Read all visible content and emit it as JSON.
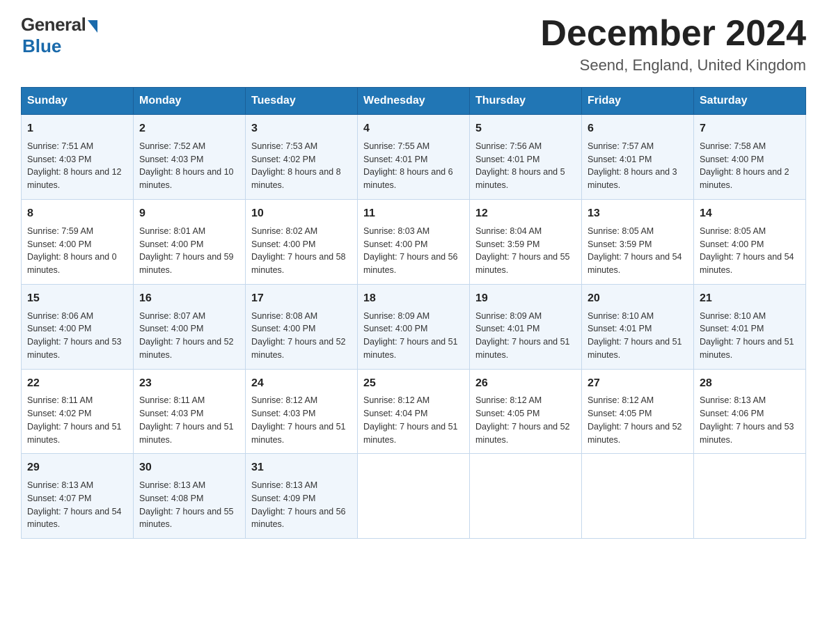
{
  "logo": {
    "general": "General",
    "blue": "Blue"
  },
  "title": "December 2024",
  "location": "Seend, England, United Kingdom",
  "days_of_week": [
    "Sunday",
    "Monday",
    "Tuesday",
    "Wednesday",
    "Thursday",
    "Friday",
    "Saturday"
  ],
  "weeks": [
    [
      {
        "day": "1",
        "sunrise": "7:51 AM",
        "sunset": "4:03 PM",
        "daylight": "8 hours and 12 minutes."
      },
      {
        "day": "2",
        "sunrise": "7:52 AM",
        "sunset": "4:03 PM",
        "daylight": "8 hours and 10 minutes."
      },
      {
        "day": "3",
        "sunrise": "7:53 AM",
        "sunset": "4:02 PM",
        "daylight": "8 hours and 8 minutes."
      },
      {
        "day": "4",
        "sunrise": "7:55 AM",
        "sunset": "4:01 PM",
        "daylight": "8 hours and 6 minutes."
      },
      {
        "day": "5",
        "sunrise": "7:56 AM",
        "sunset": "4:01 PM",
        "daylight": "8 hours and 5 minutes."
      },
      {
        "day": "6",
        "sunrise": "7:57 AM",
        "sunset": "4:01 PM",
        "daylight": "8 hours and 3 minutes."
      },
      {
        "day": "7",
        "sunrise": "7:58 AM",
        "sunset": "4:00 PM",
        "daylight": "8 hours and 2 minutes."
      }
    ],
    [
      {
        "day": "8",
        "sunrise": "7:59 AM",
        "sunset": "4:00 PM",
        "daylight": "8 hours and 0 minutes."
      },
      {
        "day": "9",
        "sunrise": "8:01 AM",
        "sunset": "4:00 PM",
        "daylight": "7 hours and 59 minutes."
      },
      {
        "day": "10",
        "sunrise": "8:02 AM",
        "sunset": "4:00 PM",
        "daylight": "7 hours and 58 minutes."
      },
      {
        "day": "11",
        "sunrise": "8:03 AM",
        "sunset": "4:00 PM",
        "daylight": "7 hours and 56 minutes."
      },
      {
        "day": "12",
        "sunrise": "8:04 AM",
        "sunset": "3:59 PM",
        "daylight": "7 hours and 55 minutes."
      },
      {
        "day": "13",
        "sunrise": "8:05 AM",
        "sunset": "3:59 PM",
        "daylight": "7 hours and 54 minutes."
      },
      {
        "day": "14",
        "sunrise": "8:05 AM",
        "sunset": "4:00 PM",
        "daylight": "7 hours and 54 minutes."
      }
    ],
    [
      {
        "day": "15",
        "sunrise": "8:06 AM",
        "sunset": "4:00 PM",
        "daylight": "7 hours and 53 minutes."
      },
      {
        "day": "16",
        "sunrise": "8:07 AM",
        "sunset": "4:00 PM",
        "daylight": "7 hours and 52 minutes."
      },
      {
        "day": "17",
        "sunrise": "8:08 AM",
        "sunset": "4:00 PM",
        "daylight": "7 hours and 52 minutes."
      },
      {
        "day": "18",
        "sunrise": "8:09 AM",
        "sunset": "4:00 PM",
        "daylight": "7 hours and 51 minutes."
      },
      {
        "day": "19",
        "sunrise": "8:09 AM",
        "sunset": "4:01 PM",
        "daylight": "7 hours and 51 minutes."
      },
      {
        "day": "20",
        "sunrise": "8:10 AM",
        "sunset": "4:01 PM",
        "daylight": "7 hours and 51 minutes."
      },
      {
        "day": "21",
        "sunrise": "8:10 AM",
        "sunset": "4:01 PM",
        "daylight": "7 hours and 51 minutes."
      }
    ],
    [
      {
        "day": "22",
        "sunrise": "8:11 AM",
        "sunset": "4:02 PM",
        "daylight": "7 hours and 51 minutes."
      },
      {
        "day": "23",
        "sunrise": "8:11 AM",
        "sunset": "4:03 PM",
        "daylight": "7 hours and 51 minutes."
      },
      {
        "day": "24",
        "sunrise": "8:12 AM",
        "sunset": "4:03 PM",
        "daylight": "7 hours and 51 minutes."
      },
      {
        "day": "25",
        "sunrise": "8:12 AM",
        "sunset": "4:04 PM",
        "daylight": "7 hours and 51 minutes."
      },
      {
        "day": "26",
        "sunrise": "8:12 AM",
        "sunset": "4:05 PM",
        "daylight": "7 hours and 52 minutes."
      },
      {
        "day": "27",
        "sunrise": "8:12 AM",
        "sunset": "4:05 PM",
        "daylight": "7 hours and 52 minutes."
      },
      {
        "day": "28",
        "sunrise": "8:13 AM",
        "sunset": "4:06 PM",
        "daylight": "7 hours and 53 minutes."
      }
    ],
    [
      {
        "day": "29",
        "sunrise": "8:13 AM",
        "sunset": "4:07 PM",
        "daylight": "7 hours and 54 minutes."
      },
      {
        "day": "30",
        "sunrise": "8:13 AM",
        "sunset": "4:08 PM",
        "daylight": "7 hours and 55 minutes."
      },
      {
        "day": "31",
        "sunrise": "8:13 AM",
        "sunset": "4:09 PM",
        "daylight": "7 hours and 56 minutes."
      },
      null,
      null,
      null,
      null
    ]
  ],
  "labels": {
    "sunrise": "Sunrise:",
    "sunset": "Sunset:",
    "daylight": "Daylight:"
  }
}
